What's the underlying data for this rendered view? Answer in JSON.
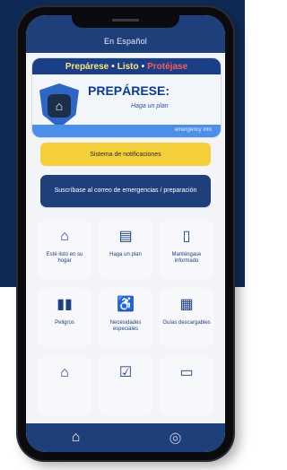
{
  "header": {
    "language_toggle": "En Español"
  },
  "banner": {
    "headline_parts": [
      "Prepárese",
      "•",
      "Listo",
      "•",
      "Protéjase"
    ],
    "title": "PREPÁRESE:",
    "tagline": "Haga un plan",
    "footer_small": "emergency info"
  },
  "actions": {
    "primary_yellow": "Sistema de notificaciones",
    "primary_blue": "Suscríbase al correo de emergencias / preparación"
  },
  "tiles": [
    {
      "label": "Esté listo en su hogar",
      "icon": "home-icon"
    },
    {
      "label": "Haga un plan",
      "icon": "clipboard-icon"
    },
    {
      "label": "Manténgase informado",
      "icon": "phone-icon"
    },
    {
      "label": "Peligros",
      "icon": "signal-icon"
    },
    {
      "label": "Necesidades especiales",
      "icon": "accessibility-icon"
    },
    {
      "label": "Guías descargables",
      "icon": "document-icon"
    },
    {
      "label": "",
      "icon": "house-icon"
    },
    {
      "label": "",
      "icon": "checklist-icon"
    },
    {
      "label": "",
      "icon": "card-icon"
    }
  ],
  "bottom_nav": {
    "home_icon": "home-icon",
    "globe_icon": "globe-icon"
  },
  "colors": {
    "navy": "#1f3f7b",
    "yellow": "#f4cf3a",
    "background": "#f3f4f7"
  }
}
